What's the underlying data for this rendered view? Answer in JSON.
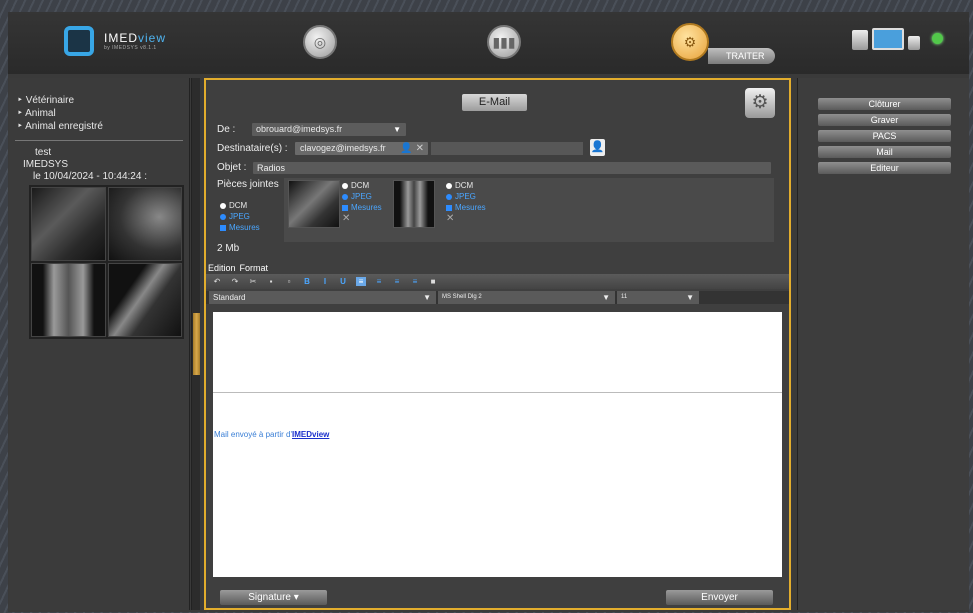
{
  "app": {
    "logo_name_1": "IMED",
    "logo_name_2": "view",
    "logo_sub": "by IMEDSYS v8.1.1",
    "traiter_label": "TRAITER"
  },
  "left": {
    "items": [
      "Vétérinaire",
      "Animal",
      "Animal enregistré"
    ],
    "study_title": "test",
    "study_org": "IMEDSYS",
    "study_date": "le 10/04/2024 - 10:44:24 :"
  },
  "email": {
    "title": "E-Mail",
    "from_label": "De :",
    "from_value": "obrouard@imedsys.fr",
    "to_label": "Destinataire(s) :",
    "to_value": "clavogez@imedsys.fr",
    "subject_label": "Objet :",
    "subject_value": "Radios",
    "attachments_label": "Pièces jointes",
    "size": "2 Mb",
    "opt_dcm": "DCM",
    "opt_jpeg": "JPEG",
    "opt_mesures": "Mesures",
    "menu_edition": "Edition",
    "menu_format": "Format",
    "style_value": "Standard",
    "font_value": "MS Shell Dlg 2",
    "size_value": "11",
    "body_footer_text": "Mail envoyé à partir d'",
    "body_footer_link": "IMEDview",
    "signature_label": "Signature",
    "send_label": "Envoyer"
  },
  "right": {
    "buttons": [
      "Clôturer",
      "Graver",
      "PACS",
      "Mail",
      "Editeur"
    ]
  },
  "colors": {
    "accent": "#e2ad2d",
    "link": "#1a2fcc",
    "blue_option": "#4aa6ff",
    "status_led": "#52c84a"
  }
}
